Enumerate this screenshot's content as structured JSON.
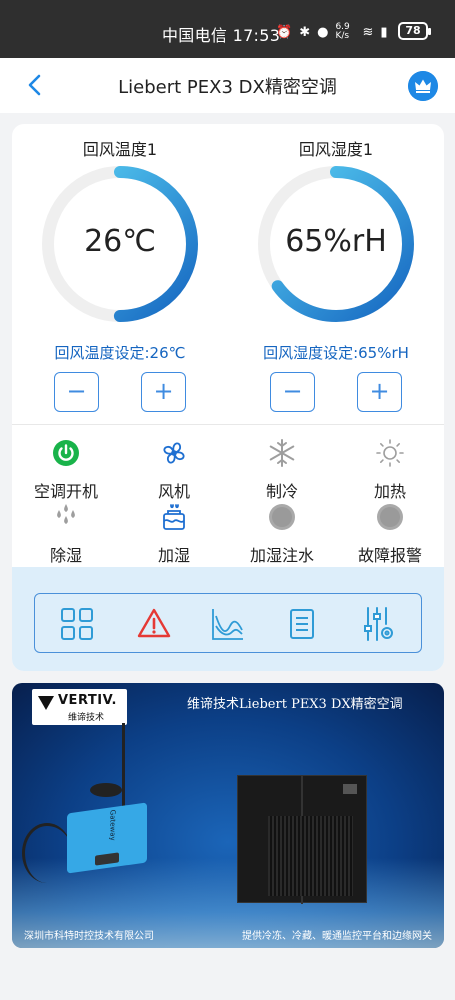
{
  "status_bar": {
    "carrier_time": "中国电信 17:53",
    "net_speed": "6.9 K/s",
    "battery": "78"
  },
  "app_bar": {
    "title": "Liebert PEX3 DX精密空调",
    "back_icon": "chevron-left-icon",
    "crown_icon": "crown-icon"
  },
  "gauges": [
    {
      "label": "回风温度1",
      "value": "26℃",
      "setpoint": "回风温度设定:26℃",
      "fill_fraction": 0.5,
      "minus": "−",
      "plus": "+"
    },
    {
      "label": "回风湿度1",
      "value": "65%rH",
      "setpoint": "回风湿度设定:65%rH",
      "fill_fraction": 0.65,
      "minus": "−",
      "plus": "+"
    }
  ],
  "statuses": [
    {
      "label": "空调开机",
      "icon": "power-icon",
      "color": "#19b34a"
    },
    {
      "label": "风机",
      "icon": "fan-icon",
      "color": "#1e6fd1"
    },
    {
      "label": "制冷",
      "icon": "snowflake-icon",
      "color": "#9e9e9e"
    },
    {
      "label": "加热",
      "icon": "sun-icon",
      "color": "#9e9e9e"
    },
    {
      "label": "除湿",
      "icon": "droplets-icon",
      "color": "#9e9e9e"
    },
    {
      "label": "加湿",
      "icon": "humidifier-icon",
      "color": "#1e6fd1"
    },
    {
      "label": "加湿注水",
      "icon": "indicator-dot-icon",
      "color": "#9e9e9e"
    },
    {
      "label": "故障报警",
      "icon": "indicator-dot-icon",
      "color": "#9e9e9e"
    }
  ],
  "toolbar": [
    {
      "icon": "grid-icon"
    },
    {
      "icon": "alarm-warning-icon"
    },
    {
      "icon": "trend-chart-icon"
    },
    {
      "icon": "list-icon"
    },
    {
      "icon": "settings-sliders-icon"
    }
  ],
  "banner": {
    "logo": "VERTIV.",
    "logo_sub": "维谛技术",
    "title": "维谛技术Liebert PEX3 DX精密空调",
    "gateway_label": "Gateway",
    "footer_left": "深圳市科特时控技术有限公司",
    "footer_right": "提供冷冻、冷藏、暖通监控平台和边缘网关"
  },
  "colors": {
    "accent": "#1e88e5",
    "gauge_gradient_start": "#1565c0",
    "gauge_gradient_end": "#5ad2f4",
    "track": "#efefef"
  }
}
